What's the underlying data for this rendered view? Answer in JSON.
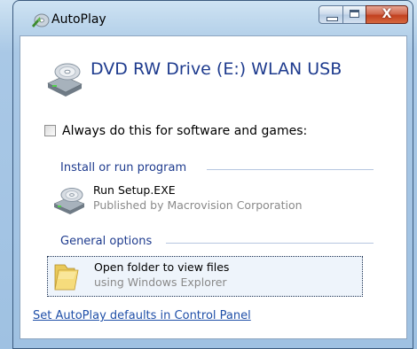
{
  "window": {
    "title": "AutoPlay",
    "icon": "autoplay-icon",
    "controls": {
      "minimize": "minimize-icon",
      "maximize": "maximize-icon",
      "close_glyph": "X"
    }
  },
  "device": {
    "title": "DVD RW Drive (E:) WLAN USB",
    "icon": "dvd-drive-icon"
  },
  "always_checkbox": {
    "label": "Always do this for software and games:",
    "checked": false
  },
  "sections": {
    "install": {
      "heading": "Install or run program",
      "item": {
        "title": "Run Setup.EXE",
        "subtitle": "Published by Macrovision Corporation",
        "icon": "setup-drive-icon"
      }
    },
    "general": {
      "heading": "General options",
      "item": {
        "title": "Open folder to view files",
        "subtitle": "using Windows Explorer",
        "icon": "folder-icon"
      }
    }
  },
  "footer_link": "Set AutoPlay defaults in Control Panel",
  "colors": {
    "heading_blue": "#1e3b8e",
    "link_blue": "#1f4fa8",
    "close_red": "#c2401f"
  }
}
